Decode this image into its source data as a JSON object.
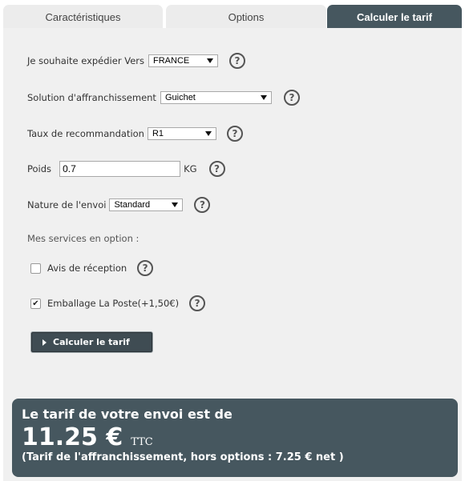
{
  "tabs": {
    "caracteristiques": "Caractéristiques",
    "options": "Options",
    "calculer": "Calculer le tarif"
  },
  "form": {
    "destination": {
      "label": "Je souhaite expédier Vers",
      "value": "FRANCE"
    },
    "affranchissement": {
      "label": "Solution d'affranchissement",
      "value": "Guichet"
    },
    "recommandation": {
      "label": "Taux de recommandation",
      "value": "R1"
    },
    "poids": {
      "label": "Poids",
      "value": "0.7",
      "unit": "KG"
    },
    "nature": {
      "label": "Nature de l'envoi",
      "value": "Standard"
    },
    "services_title": "Mes services en option :",
    "avis": {
      "label": "Avis de réception",
      "checked": false
    },
    "emballage": {
      "label": "Emballage La Poste(+1,50€)",
      "checked": true
    },
    "help_glyph": "?",
    "submit_label": "Calculer le tarif"
  },
  "result": {
    "heading": "Le tarif de votre envoi est de",
    "price": "11.25 €",
    "price_suffix": "TTC",
    "detail": "(Tarif de l'affranchissement, hors options : 7.25 € net )"
  },
  "colors": {
    "accent": "#46575f",
    "panel": "#f0f0f0"
  },
  "icons": {
    "help": "question-circle-icon",
    "checkmark": "checkmark-icon",
    "dropdown": "chevron-down-icon",
    "button": "caret-right-icon"
  }
}
